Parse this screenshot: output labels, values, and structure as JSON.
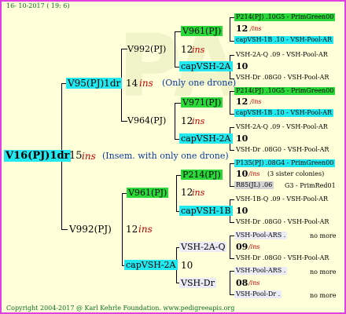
{
  "header_date": "16- 10-2017 ( 19: 6)",
  "footer": "Copyright 2004-2017 @ Karl Kehrle Foundation.   www.pedigreeapis.org",
  "root": {
    "id": "V16(PJ)1dr",
    "num": "15",
    "ins": "ins",
    "note": "(Insem. with only one drone)"
  },
  "upper": {
    "parent": "V95(PJ)1dr",
    "num": "14",
    "ins": "ins",
    "note": "(Only one drone)",
    "a": {
      "label": "V992(PJ)",
      "num": "12",
      "ins": "ins",
      "top": {
        "label": "V961(PJ)",
        "l1": "P214(PJ) .10G5 - PrimGreen00",
        "n": "12",
        "ins": "/ins",
        "l3": "capVSH-1B .10 - VSH-Pool-AR"
      },
      "bot": {
        "label": "capVSH-2A",
        "l1": "VSH-2A-Q .09 - VSH-Pool-AR",
        "n": "10",
        "l3": "VSH-Dr .08G0 - VSH-Pool-AR"
      }
    },
    "b": {
      "label": "V964(PJ)",
      "num": "12",
      "ins": "ins",
      "top": {
        "label": "V971(PJ)",
        "l1": "P214(PJ) .10G5 - PrimGreen00",
        "n": "12",
        "ins": "/ins",
        "l3": "capVSH-1B .10 - VSH-Pool-AR"
      },
      "bot": {
        "label": "capVSH-2A",
        "l1": "VSH-2A-Q .09 - VSH-Pool-AR",
        "n": "10",
        "l3": "VSH-Dr .08G0 - VSH-Pool-AR"
      }
    }
  },
  "lower": {
    "parent": "V992(PJ)",
    "num": "12",
    "ins": "ins",
    "a": {
      "label": "V961(PJ)",
      "num": "12",
      "ins": "ins",
      "top": {
        "label": "P214(PJ)",
        "l1": "P135(PJ) .08G4 - PrimGreen00",
        "n": "10",
        "ins": "/ins",
        "note": "(3 sister colonies)",
        "l3a": "R85(JL) .06",
        "l3b": "G3 - PrimRed01"
      },
      "bot": {
        "label": "capVSH-1B",
        "l1": "VSH-1B-Q .09 - VSH-Pool-AR",
        "n": "10",
        "l3": "VSH-Dr .08G0 - VSH-Pool-AR"
      }
    },
    "b": {
      "label": "capVSH-2A",
      "num": "10",
      "top": {
        "label": "VSH-2A-Q",
        "num": "09",
        "ins": "/ins",
        "l1": "VSH-Pool-ARS .",
        "l1b": "no more",
        "l3": "VSH-Dr .08G0 - VSH-Pool-AR"
      },
      "bot": {
        "label": "VSH-Dr",
        "num": "08",
        "ins": "/ins",
        "l1": "VSH-Pool-ARS .",
        "l1b": "no more",
        "l3": "VSH-Pool-Dr .",
        "l3b": "no more"
      }
    }
  }
}
